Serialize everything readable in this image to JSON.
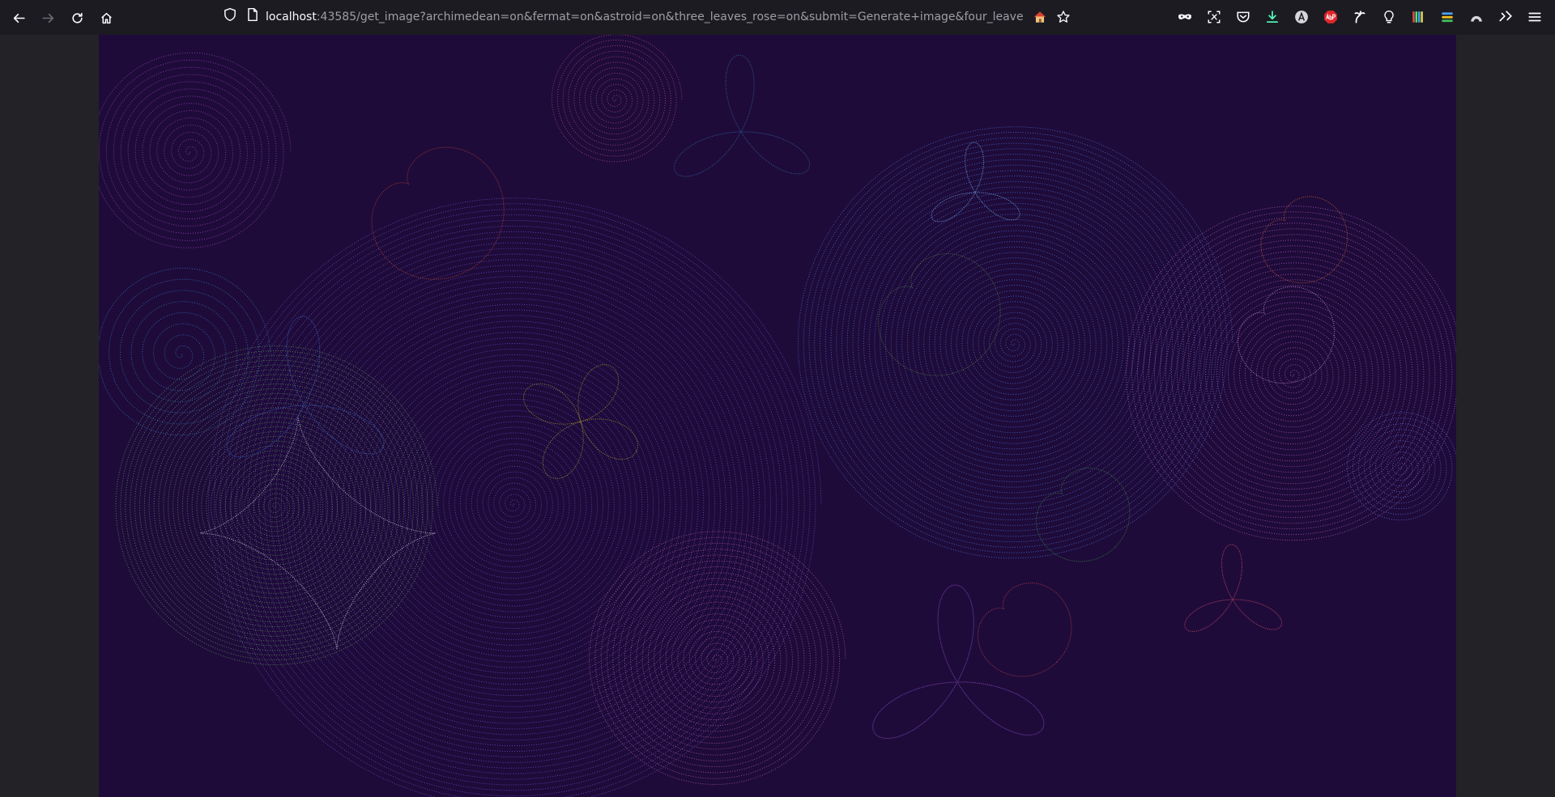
{
  "browser": {
    "url_host": "localhost",
    "url_rest": ":43585/get_image?archimedean=on&fermat=on&astroid=on&three_leaves_rose=on&submit=Generate+image&four_leaves_rose=on&",
    "nav_icons": [
      "back-arrow-icon",
      "forward-arrow-icon",
      "reload-icon",
      "home-icon"
    ],
    "urlbar_icons": [
      "shield-icon",
      "page-icon",
      "home-emoji-icon",
      "bookmark-star-icon"
    ],
    "extension_icons": [
      "mask-icon",
      "screenshot-icon",
      "pocket-icon",
      "download-icon",
      "account-circle-icon",
      "adblock-plus-icon",
      "extension-icon",
      "bulb-icon",
      "colorbars-icon",
      "stack-icon",
      "arc-icon",
      "extensions-icon",
      "menu-icon"
    ]
  },
  "page": {
    "background_color": "#1e0b3a",
    "curves": [
      {
        "kind": "spiral",
        "color": "#b04fc6"
      },
      {
        "kind": "spiral",
        "color": "#d05a8a"
      },
      {
        "kind": "spiral",
        "color": "#3a8fd6"
      },
      {
        "kind": "spiral",
        "color": "#7a5cd8"
      },
      {
        "kind": "spiral",
        "color": "#5a7fe6"
      },
      {
        "kind": "spiral",
        "color": "#c86ad0"
      },
      {
        "kind": "spiral",
        "color": "#6aa860"
      },
      {
        "kind": "spiral",
        "color": "#d06ab8"
      },
      {
        "kind": "spiral",
        "color": "#6b7fe6"
      },
      {
        "kind": "cardioid",
        "color": "#d84a2e"
      },
      {
        "kind": "cardioid",
        "color": "#e06a2e"
      },
      {
        "kind": "cardioid",
        "color": "#e04848"
      },
      {
        "kind": "cardioid",
        "color": "#d89ae0"
      },
      {
        "kind": "cardioid",
        "color": "#3a9a3a"
      },
      {
        "kind": "cardioid",
        "color": "#5a8a3a"
      },
      {
        "kind": "rose4",
        "color": "#c8b020"
      },
      {
        "kind": "rose3",
        "color": "#3a78b8"
      },
      {
        "kind": "rose3",
        "color": "#6a9ad8"
      },
      {
        "kind": "rose3",
        "color": "#8a4ab8"
      },
      {
        "kind": "rose3",
        "color": "#d04a6a"
      },
      {
        "kind": "rose3",
        "color": "#3a6ac8"
      },
      {
        "kind": "astroid",
        "color": "#e0e0f0"
      }
    ]
  }
}
